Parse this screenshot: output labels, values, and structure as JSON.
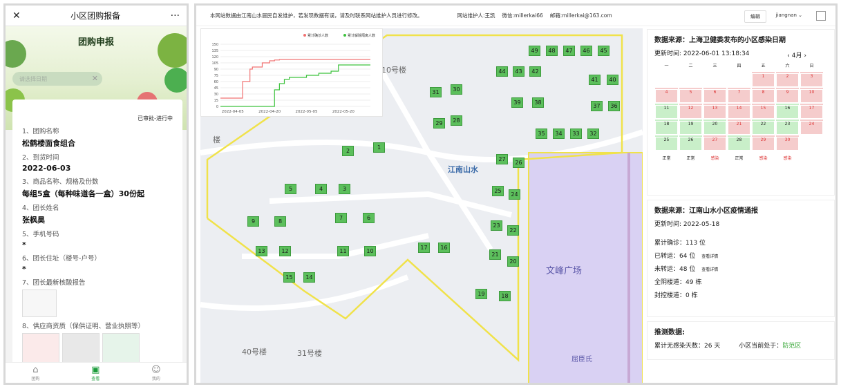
{
  "left": {
    "title": "小区团购报备",
    "close_icon": "close-icon",
    "more_icon": "more-icon",
    "banner_title": "团购申报",
    "search_placeholder": "请选择日期",
    "status": "已审批-进行中",
    "fields": [
      {
        "label": "1、团购名称",
        "value": "松鹤楼面食组合"
      },
      {
        "label": "2、到货时间",
        "value": "2022-06-03"
      },
      {
        "label": "3、商品名称、规格及份数",
        "value": "每组5盒（每种味道各一盒）30份起"
      },
      {
        "label": "4、团长姓名",
        "value": "张枫昊"
      },
      {
        "label": "5、手机号码",
        "value": "*"
      },
      {
        "label": "6、团长住址（楼号-户号）",
        "value": "*"
      },
      {
        "label": "7、团长最新核酸报告",
        "value": ""
      },
      {
        "label": "8、供应商资质（保供证明、营业执照等）",
        "value": ""
      }
    ],
    "tabs": [
      "团购",
      "查看",
      "我的"
    ]
  },
  "right": {
    "notice": "本网站数据由江南山水居民自发维护，若发现数据有误，请及时联系网站维护人员进行修改。",
    "maintainer": "网站维护人:王凯",
    "wechat": "微信:millerkai66",
    "email": "邮箱:millerkai@163.com",
    "edit_label": "编辑",
    "user_label": "jiangnan",
    "map_labels": {
      "area": "江南山水",
      "plaza": "文峰广场",
      "b10": "10号楼",
      "b40": "40号楼",
      "b31": "31号楼",
      "poi": "屈臣氏",
      "lou": "楼"
    },
    "buildings": [
      {
        "n": "49"
      },
      {
        "n": "48"
      },
      {
        "n": "47"
      },
      {
        "n": "46"
      },
      {
        "n": "45"
      },
      {
        "n": "44"
      },
      {
        "n": "43"
      },
      {
        "n": "42"
      },
      {
        "n": "41"
      },
      {
        "n": "40"
      },
      {
        "n": "31"
      },
      {
        "n": "30"
      },
      {
        "n": "39"
      },
      {
        "n": "38"
      },
      {
        "n": "37"
      },
      {
        "n": "36"
      },
      {
        "n": "29"
      },
      {
        "n": "28"
      },
      {
        "n": "35"
      },
      {
        "n": "34"
      },
      {
        "n": "33"
      },
      {
        "n": "32"
      },
      {
        "n": "2"
      },
      {
        "n": "1"
      },
      {
        "n": "27"
      },
      {
        "n": "26"
      },
      {
        "n": "5"
      },
      {
        "n": "4"
      },
      {
        "n": "3"
      },
      {
        "n": "25"
      },
      {
        "n": "24"
      },
      {
        "n": "9"
      },
      {
        "n": "8"
      },
      {
        "n": "7"
      },
      {
        "n": "6"
      },
      {
        "n": "23"
      },
      {
        "n": "22"
      },
      {
        "n": "13"
      },
      {
        "n": "12"
      },
      {
        "n": "11"
      },
      {
        "n": "10"
      },
      {
        "n": "17"
      },
      {
        "n": "16"
      },
      {
        "n": "21"
      },
      {
        "n": "20"
      },
      {
        "n": "15"
      },
      {
        "n": "14"
      },
      {
        "n": "19"
      },
      {
        "n": "18"
      }
    ],
    "calendar": {
      "header": "数据来源：上海卫健委发布的小区感染日期",
      "updated": "更新时间: 2022-06-01 13:18:34",
      "month": "4月",
      "weekdays": [
        "一",
        "二",
        "三",
        "四",
        "五",
        "六",
        "日"
      ],
      "bad_label": "感染",
      "ok_label": "正常",
      "days": [
        {
          "d": "",
          "s": "e"
        },
        {
          "d": "",
          "s": "e"
        },
        {
          "d": "",
          "s": "e"
        },
        {
          "d": "",
          "s": "e"
        },
        {
          "d": "1",
          "s": "b"
        },
        {
          "d": "2",
          "s": "b"
        },
        {
          "d": "3",
          "s": "b"
        },
        {
          "d": "4",
          "s": "b"
        },
        {
          "d": "5",
          "s": "b"
        },
        {
          "d": "6",
          "s": "b"
        },
        {
          "d": "7",
          "s": "b"
        },
        {
          "d": "8",
          "s": "b"
        },
        {
          "d": "9",
          "s": "b"
        },
        {
          "d": "10",
          "s": "b"
        },
        {
          "d": "11",
          "s": "o"
        },
        {
          "d": "12",
          "s": "b"
        },
        {
          "d": "13",
          "s": "b"
        },
        {
          "d": "14",
          "s": "b"
        },
        {
          "d": "15",
          "s": "b"
        },
        {
          "d": "16",
          "s": "o"
        },
        {
          "d": "17",
          "s": "b"
        },
        {
          "d": "18",
          "s": "o"
        },
        {
          "d": "19",
          "s": "o"
        },
        {
          "d": "20",
          "s": "o"
        },
        {
          "d": "21",
          "s": "b"
        },
        {
          "d": "22",
          "s": "o"
        },
        {
          "d": "23",
          "s": "o"
        },
        {
          "d": "24",
          "s": "b"
        },
        {
          "d": "25",
          "s": "o"
        },
        {
          "d": "26",
          "s": "o"
        },
        {
          "d": "27",
          "s": "b"
        },
        {
          "d": "28",
          "s": "o"
        },
        {
          "d": "29",
          "s": "b"
        },
        {
          "d": "30",
          "s": "b"
        },
        {
          "d": "",
          "s": "e"
        }
      ]
    },
    "report": {
      "header": "数据来源：江南山水小区疫情通报",
      "updated": "更新时间: 2022-05-18",
      "confirmed": "累计确诊：113 位",
      "transferred": "已转运：64 位",
      "not_transferred": "未转运：48 位",
      "detail_link": "查看详情",
      "sealed_all": "全阴楼道：49 栋",
      "locked": "封控楼道：0 栋"
    },
    "predict": {
      "header": "推测数据:",
      "days_free": "累计无感染天数：26 天",
      "zone_label": "小区当前处于：",
      "zone_value": "防范区",
      "zone_color": "#3aa83a"
    }
  },
  "chart_data": {
    "type": "line",
    "x": [
      "2022-03-31",
      "2022-04-05",
      "2022-04-09",
      "2022-04-10",
      "2022-04-12",
      "2022-04-13",
      "2022-04-17",
      "2022-04-20",
      "2022-04-22",
      "2022-04-24",
      "2022-04-26",
      "2022-04-28",
      "2022-05-01",
      "2022-05-05",
      "2022-05-10",
      "2022-05-15",
      "2022-05-18",
      "2022-05-31"
    ],
    "xticks": [
      "2022-04-05",
      "2022-04-20",
      "2022-05-05",
      "2022-05-20"
    ],
    "yticks": [
      0,
      15,
      30,
      45,
      60,
      75,
      90,
      105,
      120,
      135,
      150
    ],
    "ylim": [
      0,
      150
    ],
    "series": [
      {
        "name": "累计确诊人数",
        "color": "#f07070",
        "values": [
          20,
          20,
          60,
          60,
          90,
          95,
          105,
          110,
          112,
          113,
          113,
          113,
          113,
          113,
          113,
          113,
          113,
          113
        ]
      },
      {
        "name": "累计解除隔离人数",
        "color": "#3cc23c",
        "values": [
          0,
          0,
          0,
          0,
          0,
          0,
          0,
          0,
          40,
          55,
          65,
          70,
          70,
          75,
          80,
          85,
          100,
          100
        ]
      }
    ]
  }
}
